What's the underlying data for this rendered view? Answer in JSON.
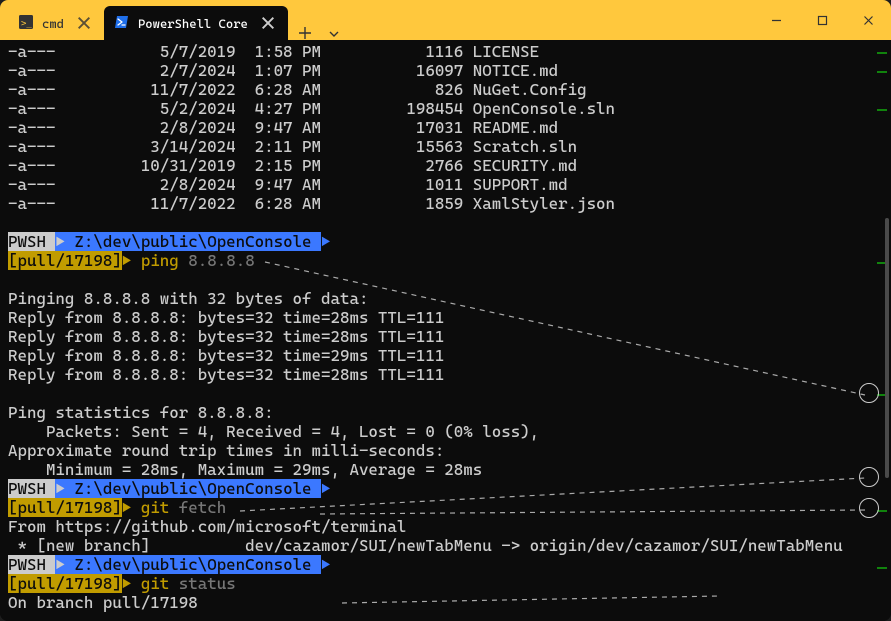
{
  "titlebar": {
    "tabs": [
      {
        "label": "cmd",
        "active": false
      },
      {
        "label": "PowerShell Core",
        "active": true
      }
    ]
  },
  "file_listing": [
    {
      "mode": "-a---",
      "date": "5/7/2019",
      "time": "1:58 PM",
      "size": "1116",
      "name": "LICENSE"
    },
    {
      "mode": "-a---",
      "date": "2/7/2024",
      "time": "1:07 PM",
      "size": "16097",
      "name": "NOTICE.md"
    },
    {
      "mode": "-a---",
      "date": "11/7/2022",
      "time": "6:28 AM",
      "size": "826",
      "name": "NuGet.Config"
    },
    {
      "mode": "-a---",
      "date": "5/2/2024",
      "time": "4:27 PM",
      "size": "198454",
      "name": "OpenConsole.sln"
    },
    {
      "mode": "-a---",
      "date": "2/8/2024",
      "time": "9:47 AM",
      "size": "17031",
      "name": "README.md"
    },
    {
      "mode": "-a---",
      "date": "3/14/2024",
      "time": "2:11 PM",
      "size": "15563",
      "name": "Scratch.sln"
    },
    {
      "mode": "-a---",
      "date": "10/31/2019",
      "time": "2:15 PM",
      "size": "2766",
      "name": "SECURITY.md"
    },
    {
      "mode": "-a---",
      "date": "2/8/2024",
      "time": "9:47 AM",
      "size": "1011",
      "name": "SUPPORT.md"
    },
    {
      "mode": "-a---",
      "date": "11/7/2022",
      "time": "6:28 AM",
      "size": "1859",
      "name": "XamlStyler.json"
    }
  ],
  "prompt": {
    "shell": "PWSH",
    "path": " Z:\\dev\\public\\OpenConsole ",
    "branch": "[pull/17198]",
    "sym": ">"
  },
  "cmd1": {
    "exe": "ping",
    "args": "8.8.8.8"
  },
  "ping_output": {
    "header": "Pinging 8.8.8.8 with 32 bytes of data:",
    "replies": [
      "Reply from 8.8.8.8: bytes=32 time=28ms TTL=111",
      "Reply from 8.8.8.8: bytes=32 time=28ms TTL=111",
      "Reply from 8.8.8.8: bytes=32 time=29ms TTL=111",
      "Reply from 8.8.8.8: bytes=32 time=28ms TTL=111"
    ],
    "stats_header": "Ping statistics for 8.8.8.8:",
    "packets": "    Packets: Sent = 4, Received = 4, Lost = 0 (0% loss),",
    "approx": "Approximate round trip times in milli-seconds:",
    "minmax": "    Minimum = 28ms, Maximum = 29ms, Average = 28ms"
  },
  "cmd2": {
    "exe": "git",
    "args": "fetch"
  },
  "git_fetch_output": {
    "from": "From https://github.com/microsoft/terminal",
    "branch": " * [new branch]          dev/cazamor/SUI/newTabMenu -> origin/dev/cazamor/SUI/newTabMenu"
  },
  "cmd3": {
    "exe": "git",
    "args": "status"
  },
  "git_status_output": {
    "line1": "On branch pull/17198"
  }
}
